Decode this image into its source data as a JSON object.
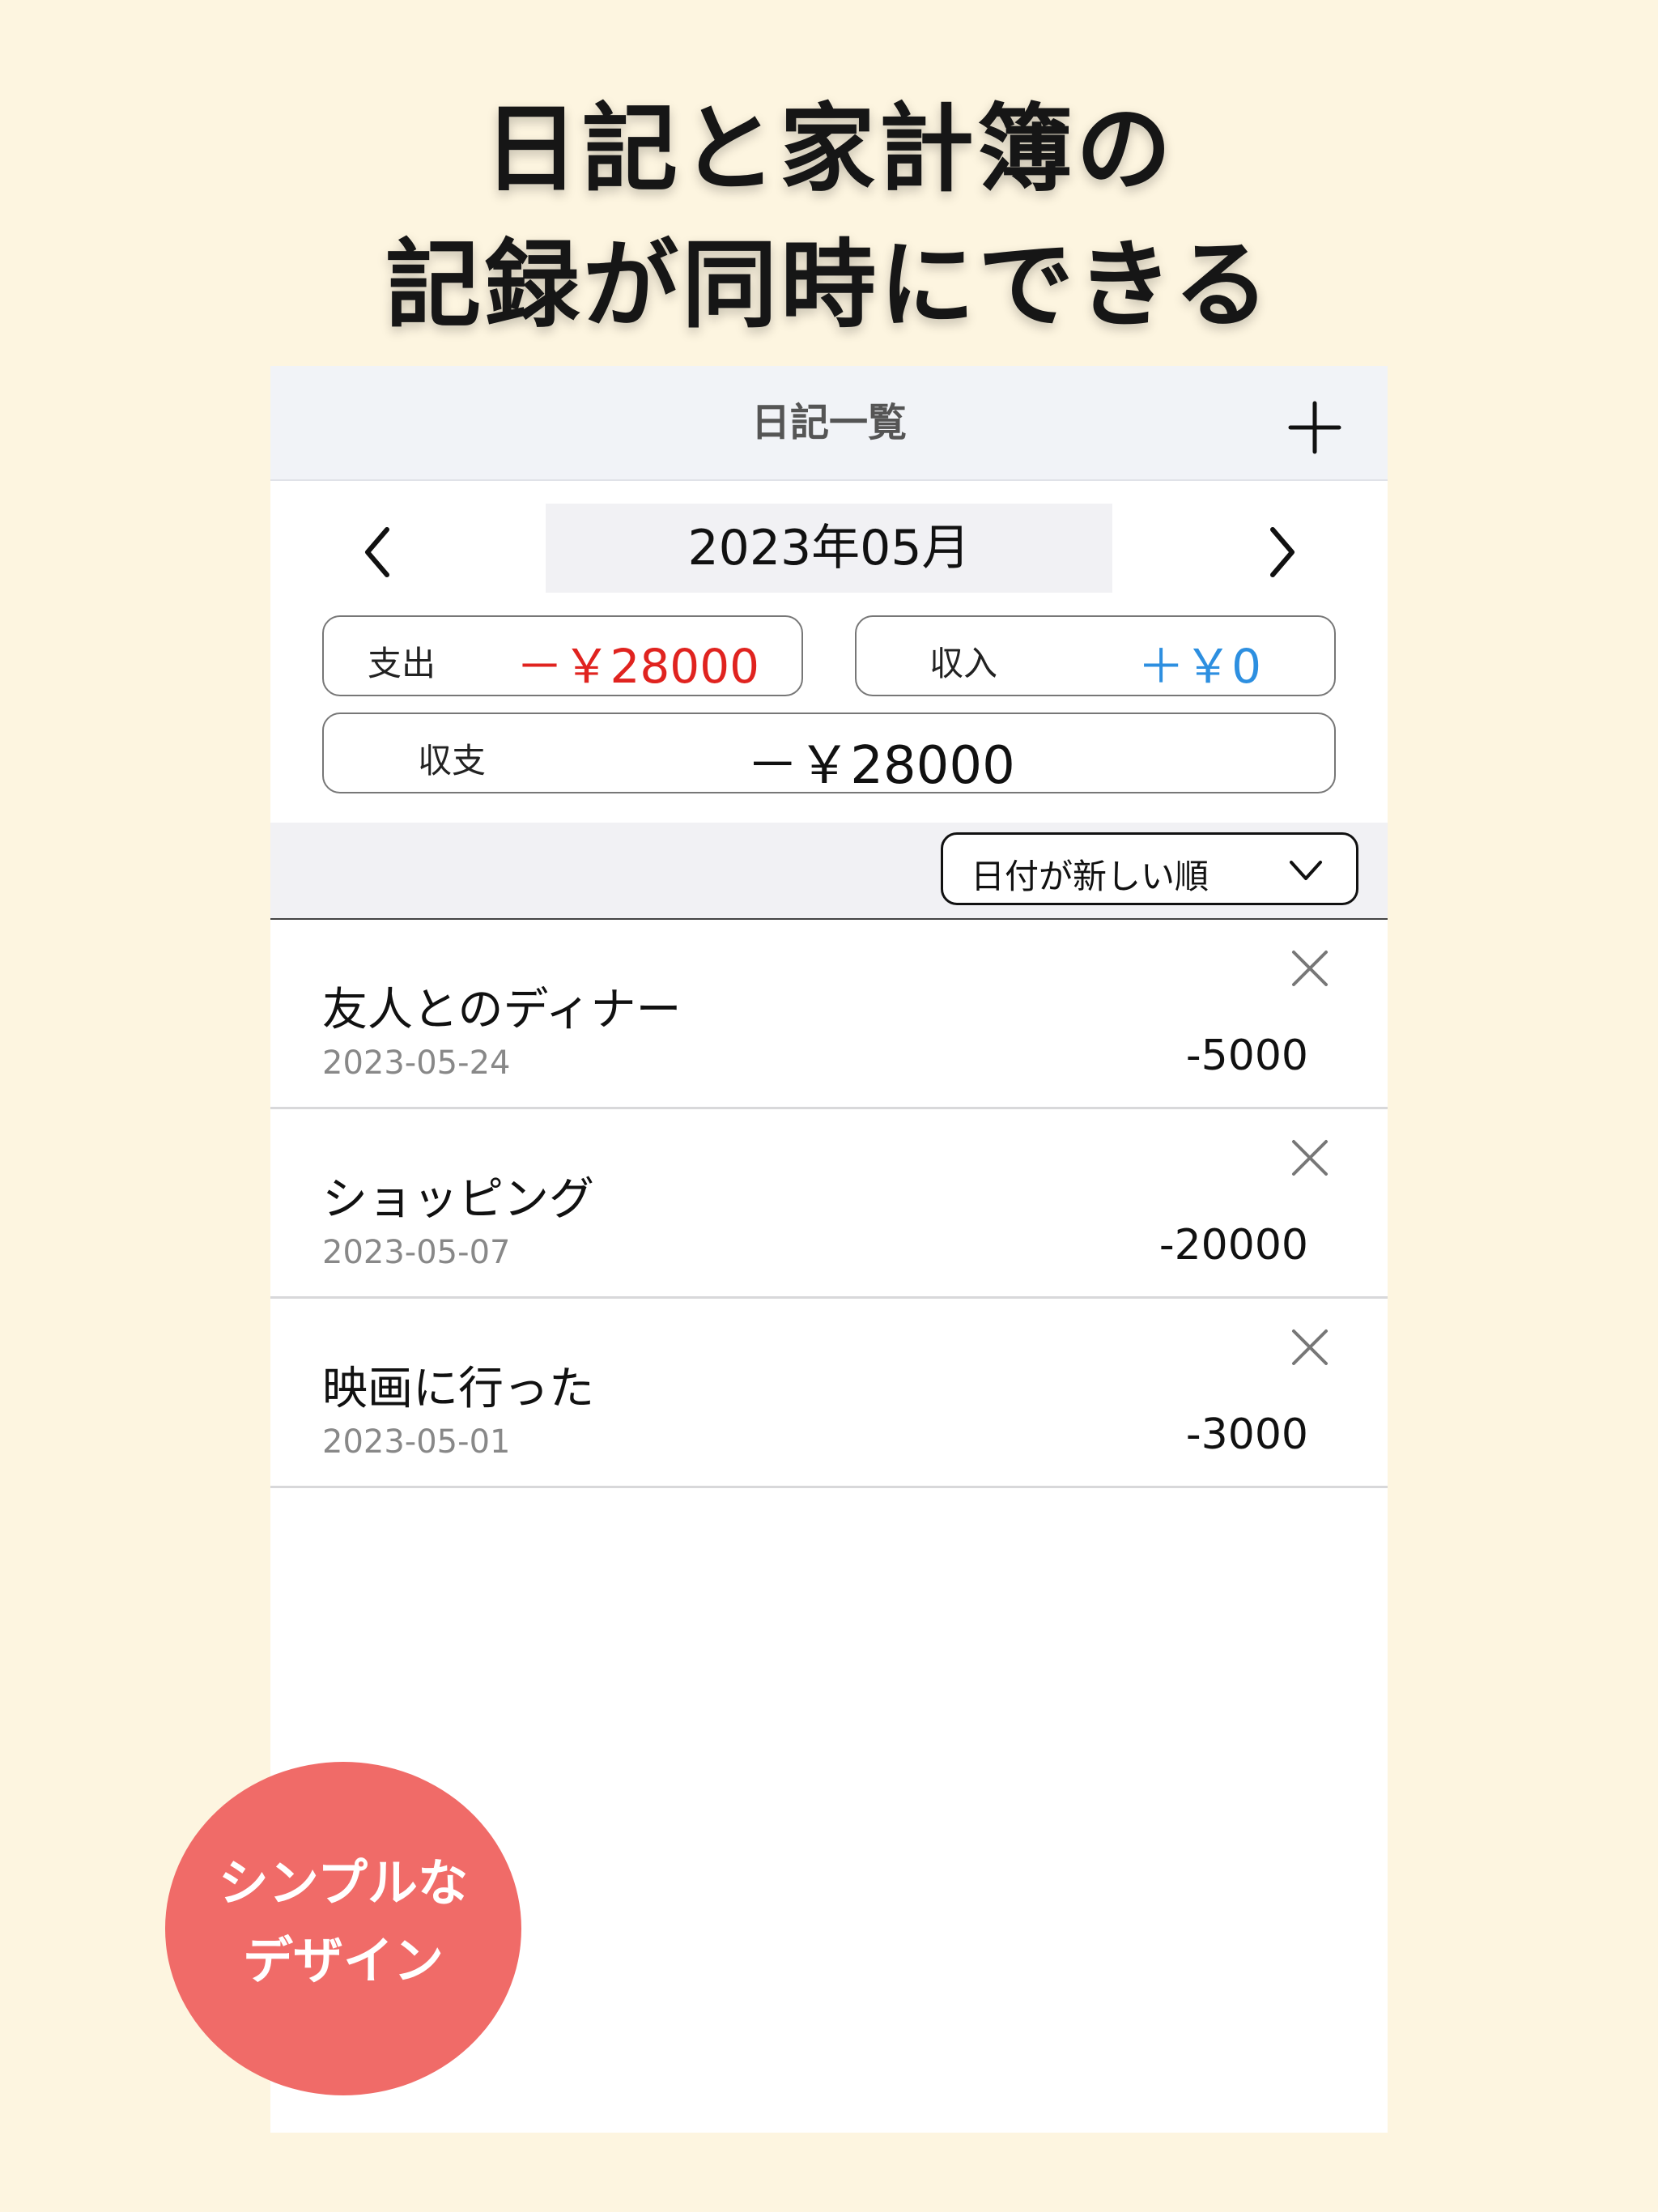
{
  "headline": {
    "line1": "日記と家計簿の",
    "line2": "記録が同時にできる"
  },
  "navbar": {
    "title": "日記一覧",
    "add_icon": "plus-icon"
  },
  "month_selector": {
    "month": "2023年05月",
    "prev_icon": "chevron-left-icon",
    "next_icon": "chevron-right-icon"
  },
  "summary": {
    "expense_label": "支出",
    "expense_value": "－￥28000",
    "income_label": "収入",
    "income_value": "＋￥0",
    "balance_label": "収支",
    "balance_value": "－￥28000",
    "expense_color": "#e0231f",
    "income_color": "#2d8fe0"
  },
  "sort": {
    "selected": "日付が新しい順",
    "icon": "chevron-down-icon"
  },
  "entries": [
    {
      "title": "友人とのディナー",
      "date": "2023-05-24",
      "amount": "-5000"
    },
    {
      "title": "ショッピング",
      "date": "2023-05-07",
      "amount": "-20000"
    },
    {
      "title": "映画に行った",
      "date": "2023-05-01",
      "amount": "-3000"
    }
  ],
  "badge": {
    "line1": "シンプルな",
    "line2": "デザイン",
    "color": "#f06b68"
  }
}
